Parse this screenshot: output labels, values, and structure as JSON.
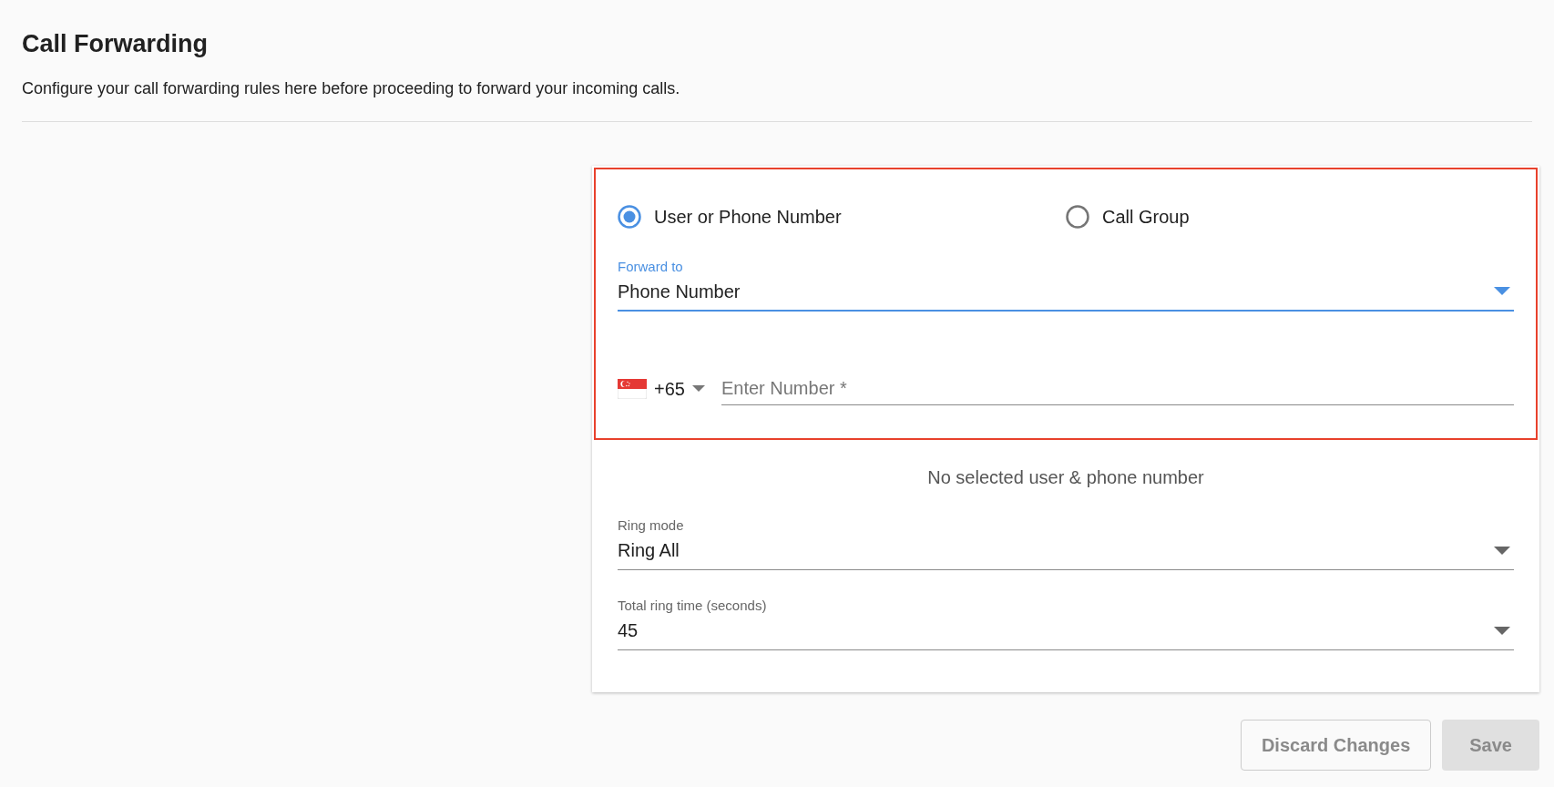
{
  "page": {
    "title": "Call Forwarding",
    "description": "Configure your call forwarding rules here before proceeding to forward your incoming calls."
  },
  "forward_section": {
    "highlighted": true,
    "target_options": [
      {
        "label": "User or Phone Number",
        "selected": true
      },
      {
        "label": "Call Group",
        "selected": false
      }
    ],
    "forward_to": {
      "label": "Forward to",
      "value": "Phone Number",
      "focused": true
    },
    "phone": {
      "country_code": "+65",
      "placeholder": "Enter Number *"
    }
  },
  "empty_message": "No selected user & phone number",
  "selects": [
    {
      "label": "Ring mode",
      "value": "Ring All"
    },
    {
      "label": "Total ring time (seconds)",
      "value": "45"
    }
  ],
  "buttons": [
    {
      "label": "Discard Changes",
      "kind": "outlined",
      "disabled": true
    },
    {
      "label": "Save",
      "kind": "filled",
      "disabled": true
    }
  ]
}
